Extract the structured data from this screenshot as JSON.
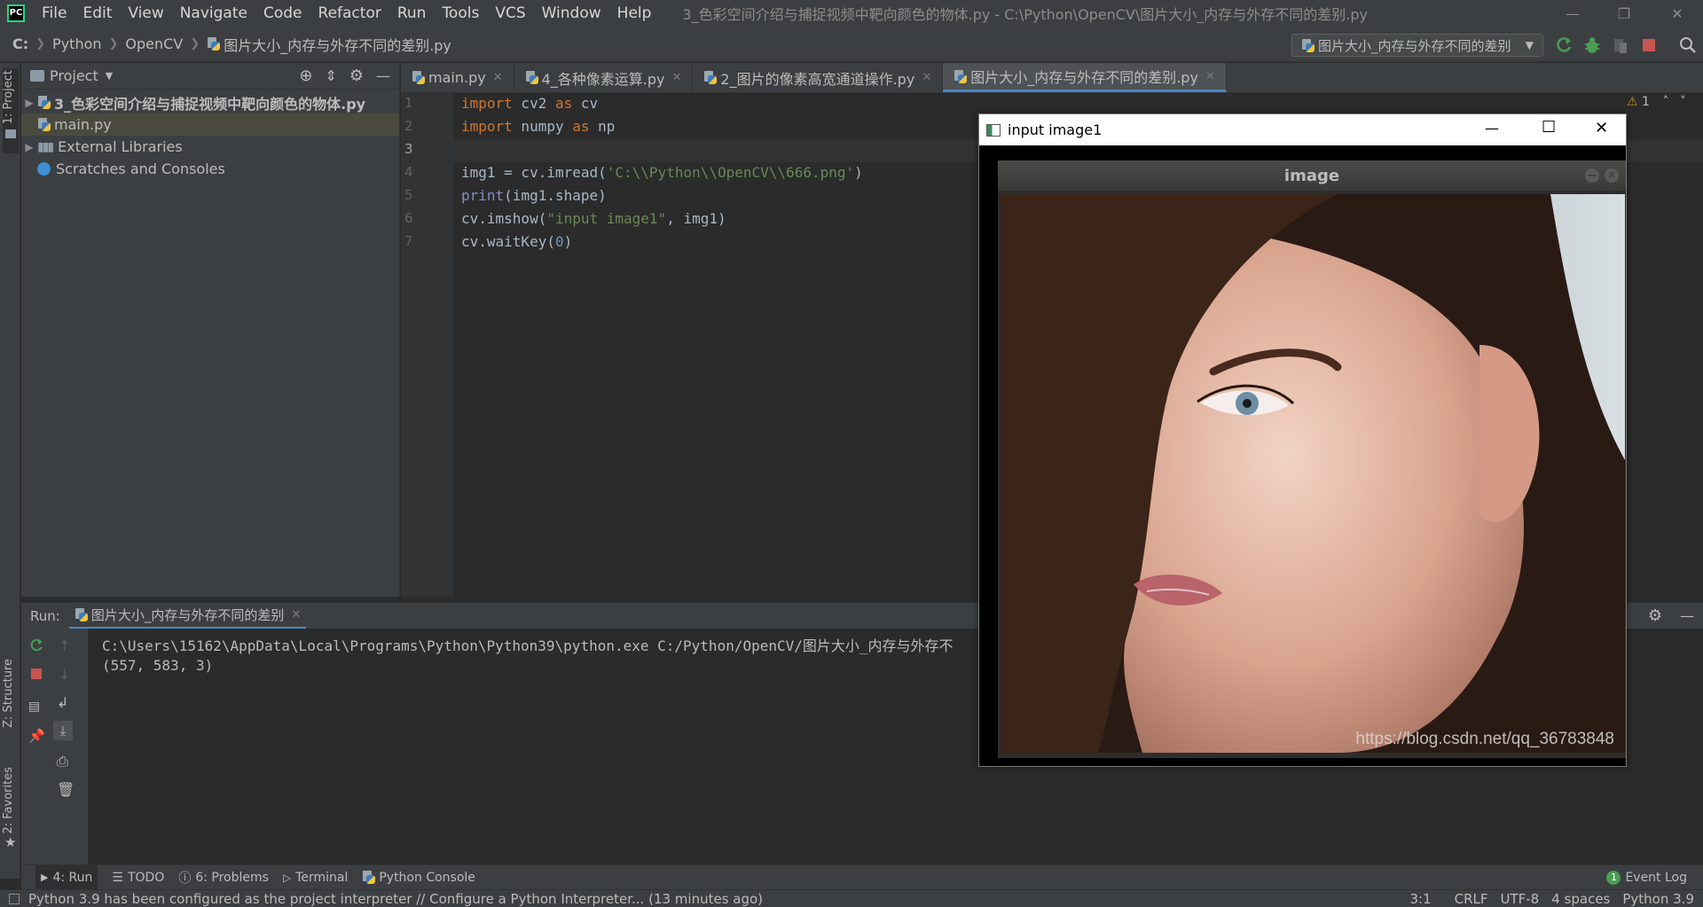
{
  "app": {
    "window_title": "3_色彩空间介绍与捕捉视频中靶向颜色的物体.py - C:\\Python\\OpenCV\\图片大小_内存与外存不同的差别.py",
    "logo": "PC"
  },
  "menu": [
    "File",
    "Edit",
    "View",
    "Navigate",
    "Code",
    "Refactor",
    "Run",
    "Tools",
    "VCS",
    "Window",
    "Help"
  ],
  "breadcrumb": [
    "C:",
    "Python",
    "OpenCV",
    "图片大小_内存与外存不同的差别.py"
  ],
  "run_config": {
    "label": "图片大小_内存与外存不同的差别"
  },
  "left_strip": {
    "project": "1: Project",
    "structure": "Z: Structure",
    "favorites": "2: Favorites"
  },
  "project_panel": {
    "title": "Project",
    "tree": [
      {
        "label": "3_色彩空间介绍与捕捉视频中靶向颜色的物体.py",
        "type": "file"
      },
      {
        "label": "main.py",
        "type": "file"
      },
      {
        "label": "External Libraries",
        "type": "lib"
      },
      {
        "label": "Scratches and Consoles",
        "type": "scratch"
      }
    ]
  },
  "editor": {
    "tabs": [
      {
        "label": "main.py",
        "active": false
      },
      {
        "label": "4_各种像素运算.py",
        "active": false
      },
      {
        "label": "2_图片的像素高宽通道操作.py",
        "active": false
      },
      {
        "label": "图片大小_内存与外存不同的差别.py",
        "active": true
      }
    ],
    "line_numbers": [
      "1",
      "2",
      "3",
      "4",
      "5",
      "6",
      "7"
    ],
    "code": {
      "l1": {
        "kw1": "import",
        "mod": " cv2 ",
        "kw2": "as",
        "alias": " cv"
      },
      "l2": {
        "kw1": "import",
        "mod": " numpy ",
        "kw2": "as",
        "alias": " np"
      },
      "l4": {
        "pre": "img1 = cv.imread(",
        "str": "'C:\\\\Python\\\\OpenCV\\\\666.png'",
        "post": ")"
      },
      "l5": {
        "fn": "print",
        "rest": "(img1.shape)"
      },
      "l6": {
        "pre": "cv.imshow(",
        "str": "\"input image1\"",
        "post": ", img1)"
      },
      "l7": {
        "pre": "cv.waitKey(",
        "num": "0",
        "post": ")"
      }
    },
    "warning_count": "1"
  },
  "run_panel": {
    "label": "Run:",
    "tab": "图片大小_内存与外存不同的差别",
    "output": [
      "C:\\Users\\15162\\AppData\\Local\\Programs\\Python\\Python39\\python.exe C:/Python/OpenCV/图片大小_内存与外存不",
      "(557, 583, 3)"
    ]
  },
  "bottom_tools": [
    {
      "label": "4: Run",
      "active": true
    },
    {
      "label": "TODO",
      "active": false
    },
    {
      "label": "6: Problems",
      "active": false
    },
    {
      "label": "Terminal",
      "active": false
    },
    {
      "label": "Python Console",
      "active": false
    }
  ],
  "event_log": {
    "count": "1",
    "label": "Event Log"
  },
  "status": {
    "message": "Python 3.9 has been configured as the project interpreter // Configure a Python Interpreter... (13 minutes ago)",
    "position": "3:1",
    "line_sep": "CRLF",
    "encoding": "UTF-8",
    "indent": "4 spaces",
    "interpreter": "Python 3.9"
  },
  "cv_window": {
    "title": "input image1",
    "inner_title": "image",
    "watermark": "https://blog.csdn.net/qq_36783848"
  },
  "colors": {
    "accent": "#4a88c7",
    "keyword": "#cc7832",
    "string": "#6a8759",
    "number": "#6897bb",
    "run_green": "#499c54",
    "stop_red": "#c75450"
  }
}
